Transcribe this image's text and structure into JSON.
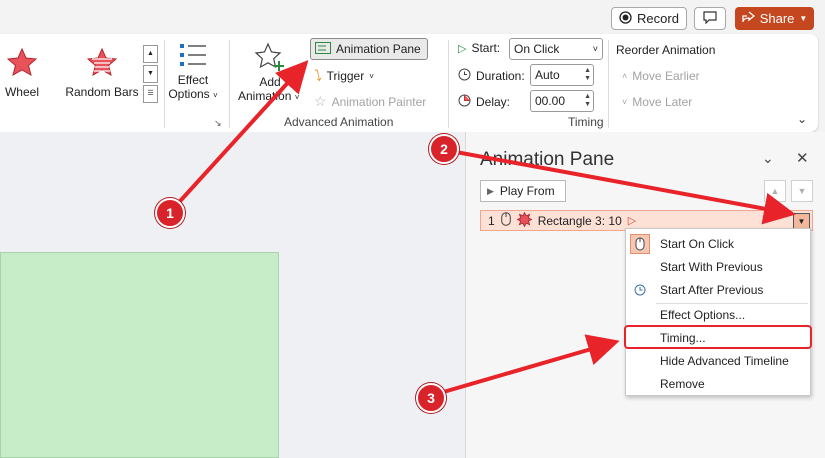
{
  "topbar": {
    "record_label": "Record",
    "share_label": "Share"
  },
  "ribbon": {
    "gallery": [
      {
        "label": "Wheel",
        "icon": "star-icon"
      },
      {
        "label": "Random Bars",
        "icon": "star-icon"
      }
    ],
    "effect_options": {
      "line1": "Effect",
      "line2": "Options"
    },
    "add_animation": {
      "line1": "Add",
      "line2": "Animation"
    },
    "animation_pane_label": "Animation Pane",
    "trigger_label": "Trigger",
    "animation_painter_label": "Animation Painter",
    "advanced_animation_label": "Advanced Animation",
    "timing": {
      "start_label": "Start:",
      "start_value": "On Click",
      "duration_label": "Duration:",
      "duration_value": "Auto",
      "delay_label": "Delay:",
      "delay_value": "00.00",
      "group_label": "Timing"
    },
    "reorder": {
      "title": "Reorder Animation",
      "move_earlier": "Move Earlier",
      "move_later": "Move Later"
    }
  },
  "pane": {
    "title": "Animation Pane",
    "play_from_label": "Play From",
    "item": {
      "number": "1",
      "label": "Rectangle 3: 10"
    }
  },
  "context_menu": {
    "items": [
      {
        "label": "Start On Click",
        "icon": "mouse-click-icon",
        "selected": true
      },
      {
        "label": "Start With Previous",
        "icon": ""
      },
      {
        "label": "Start After Previous",
        "icon": "clock-icon"
      },
      {
        "label": "Effect Options...",
        "icon": ""
      },
      {
        "label": "Timing...",
        "icon": ""
      },
      {
        "label": "Hide Advanced Timeline",
        "icon": ""
      },
      {
        "label": "Remove",
        "icon": ""
      }
    ]
  },
  "annotations": {
    "callouts": [
      "1",
      "2",
      "3"
    ],
    "color": "#e8242a"
  },
  "colors": {
    "accent": "#c4471f",
    "annotation_red": "#e8242a",
    "slide_shape_fill": "#c6edc8",
    "anim_item_bg": "#fde0d6"
  }
}
